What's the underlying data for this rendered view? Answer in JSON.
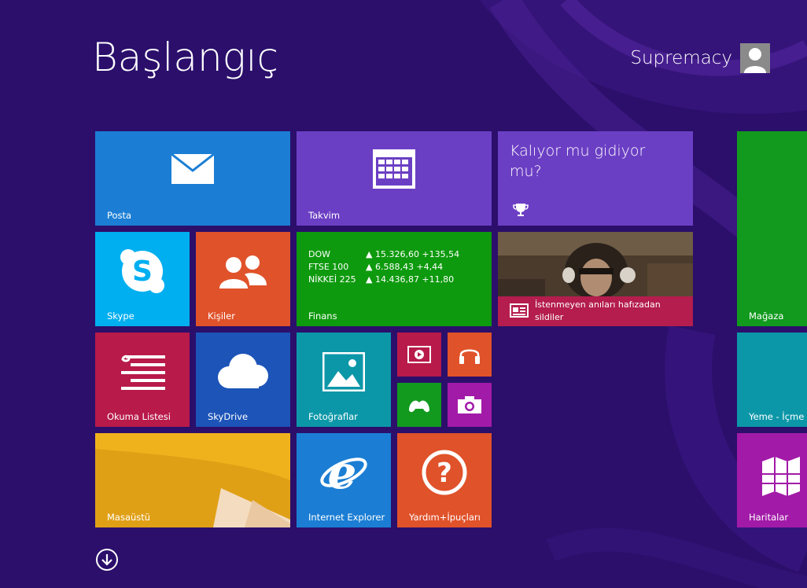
{
  "header": {
    "title": "Başlangıç",
    "user_name": "Supremacy"
  },
  "tiles": {
    "mail": {
      "label": "Posta",
      "color": "#1b7ed4",
      "icon": "mail-icon"
    },
    "calendar": {
      "label": "Takvim",
      "color": "#6b3fc4",
      "icon": "calendar-icon"
    },
    "quiz": {
      "text": "Kalıyor mu gidiyor mu?",
      "color": "#6b3fc4",
      "icon": "trophy-icon"
    },
    "store": {
      "label": "Mağaza",
      "color": "#119a1e"
    },
    "skype": {
      "label": "Skype",
      "color": "#00aff0",
      "icon": "skype-icon"
    },
    "people": {
      "label": "Kişiler",
      "color": "#e0522a",
      "icon": "people-icon"
    },
    "finance": {
      "label": "Finans",
      "color": "#0e9a0e",
      "rows": [
        {
          "name": "DOW",
          "value": "▲ 15.326,60 +135,54"
        },
        {
          "name": "FTSE 100",
          "value": "▲ 6.588,43 +4,44"
        },
        {
          "name": "NİKKEİ 225",
          "value": "▲ 14.436,87 +11,80"
        }
      ]
    },
    "news": {
      "text": "İstenmeyen anıları hafızadan sildiler",
      "color": "#b41d4d",
      "icon": "news-icon"
    },
    "reading": {
      "label": "Okuma Listesi",
      "color": "#b81a4a",
      "icon": "reading-list-icon"
    },
    "skydrive": {
      "label": "SkyDrive",
      "color": "#1c54b8",
      "icon": "cloud-icon"
    },
    "photos": {
      "label": "Fotoğraflar",
      "color": "#0c97a8",
      "icon": "photos-icon"
    },
    "video": {
      "color": "#b81a4a",
      "icon": "video-icon"
    },
    "music": {
      "color": "#e0522a",
      "icon": "headphones-icon"
    },
    "games": {
      "color": "#119a1e",
      "icon": "xbox-icon"
    },
    "camera": {
      "color": "#a21aa8",
      "icon": "camera-icon"
    },
    "food": {
      "label": "Yeme - İçme",
      "color": "#0c97a8"
    },
    "desktop": {
      "label": "Masaüstü",
      "color": "#e8a218"
    },
    "ie": {
      "label": "Internet Explorer",
      "color": "#1b7ed4",
      "icon": "ie-icon"
    },
    "help": {
      "label": "Yardım+İpuçları",
      "color": "#e0522a",
      "icon": "help-icon"
    },
    "maps": {
      "label": "Haritalar",
      "color": "#a21aa8",
      "icon": "maps-icon"
    }
  },
  "footer": {
    "icon": "down-arrow-icon"
  }
}
